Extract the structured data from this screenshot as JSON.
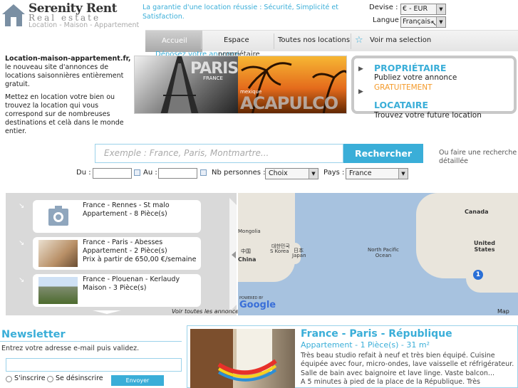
{
  "header": {
    "brand": "Serenity Rent",
    "brand_sub": "Real estate",
    "tagline": "Location - Maison - Appartement",
    "guarantee": "La garantie d'une location réussie : Sécurité, Simplicité et Satisfaction.",
    "devise_label": "Devise :",
    "devise_value": "€ - EUR",
    "langue_label": "Langue :",
    "langue_value": "Français"
  },
  "nav": {
    "items": [
      "Accueil",
      "Espace",
      "Toutes nos locations",
      "Voir ma selection"
    ],
    "deposez": "Déposez votre annonce",
    "proprietaire": "propriétaire"
  },
  "intro": {
    "title": "Location-maison-appartement.fr,",
    "p1": "le nouveau site d'annonces de locations saisonnières entièrement gratuit.",
    "p2": "Mettez en location votre bien ou trouvez la location qui vous correspond sur de nombreuses destinations et celà dans le monde entier."
  },
  "banner": {
    "city1": "PARIS",
    "country1": "FRANCE",
    "country2": "mexique",
    "city2": "ACAPULCO"
  },
  "promo": {
    "proprietaire_title": "PROPRIÉTAIRE",
    "proprietaire_text": "Publiez votre annonce",
    "gratuitement": "GRATUITEMENT",
    "locataire_title": "LOCATAIRE",
    "locataire_text": "Trouvez votre future location"
  },
  "search": {
    "placeholder": "Exemple : France, Paris, Montmartre...",
    "button": "Rechercher",
    "advanced": "Ou faire une recherche détaillée",
    "du_label": "Du :",
    "au_label": "Au :",
    "persons_label": "Nb personnes :",
    "persons_value": "Choix",
    "country_label": "Pays :",
    "country_value": "France"
  },
  "listings": [
    {
      "line1": "France - Rennes - St malo",
      "line2": "Appartement - 8 Pièce(s)",
      "line3": ""
    },
    {
      "line1": "France - Paris - Abesses",
      "line2": "Appartement - 2 Pièce(s)",
      "line3": "Prix à partir de 650,00 €/semaine"
    },
    {
      "line1": "France - Plouenan - Kerlaudy",
      "line2": "Maison - 3 Pièce(s)",
      "line3": ""
    }
  ],
  "listings_link": "Voir toutes les annonces",
  "map": {
    "labels": [
      "Canada",
      "United States",
      "North Pacific Ocean",
      "Mongolia",
      "China",
      "S Korea",
      "Japan"
    ],
    "korean": "대한민국",
    "japanese": "日本",
    "chinese": "中国",
    "marker": "1",
    "powered": "POWERED BY",
    "google": "Google",
    "map_link": "Map"
  },
  "newsletter": {
    "title": "Newsletter",
    "text": "Entrez votre adresse e-mail puis validez.",
    "subscribe": "S'inscrire",
    "unsubscribe": "Se désinscrire",
    "button": "Envoyer"
  },
  "featured": {
    "title": "France - Paris - République",
    "subtitle": "Appartement - 1 Pièce(s) - 31 m²",
    "description": "Très beau studio refait à neuf et très bien équipé. Cuisine équipée avec four, micro-ondes, lave vaisselle et réfrigérateur. Salle de bain avec baignoire et lave linge. Vaste balcon...",
    "description2": "A 5 minutes à pied de la place de la République. Très"
  },
  "colors": {
    "accent": "#3aaed8",
    "orange": "#f49a2a",
    "listing_bg": "#d9d9d9",
    "map_water": "#a7c2df"
  }
}
